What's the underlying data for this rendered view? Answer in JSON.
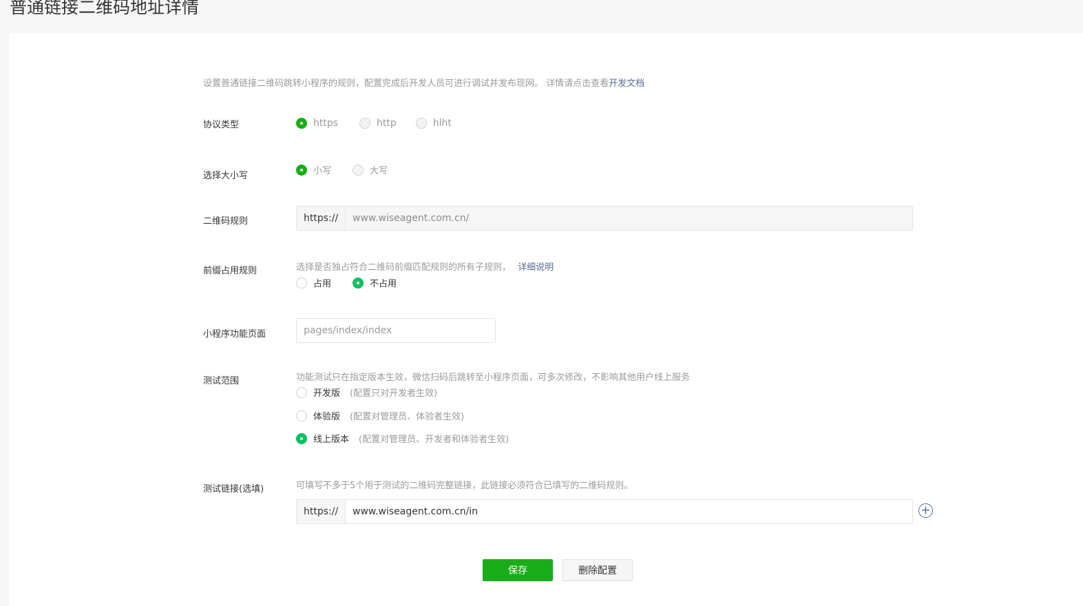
{
  "page_title": "普通链接二维码地址详情",
  "description": {
    "text": "设置普通链接二维码跳转小程序的规则，配置完成后开发人员可进行调试并发布现网。 详情请点击查看",
    "link": "开发文档"
  },
  "protocol": {
    "label": "协议类型",
    "options": [
      "https",
      "http",
      "hlht"
    ],
    "selected": "https"
  },
  "case": {
    "label": "选择大小写",
    "options": [
      "小写",
      "大写"
    ],
    "selected": "小写"
  },
  "qr_rule": {
    "label": "二维码规则",
    "prefix": "https://",
    "value": "www.wiseagent.com.cn/"
  },
  "prefix_rule": {
    "label": "前缀占用规则",
    "hint": "选择是否独占符合二维码前缀匹配规则的所有子规则，",
    "hint_link": "详细说明",
    "options": [
      "占用",
      "不占用"
    ],
    "selected": "不占用"
  },
  "page_path": {
    "label": "小程序功能页面",
    "placeholder": "pages/index/index"
  },
  "test_scope": {
    "label": "测试范围",
    "hint": "功能测试只在指定版本生效，微信扫码后跳转至小程序页面，可多次修改，不影响其他用户线上服务",
    "options": [
      {
        "name": "开发版",
        "note": "(配置只对开发者生效)"
      },
      {
        "name": "体验版",
        "note": "(配置对管理员、体验者生效)"
      },
      {
        "name": "线上版本",
        "note": "(配置对管理员、开发者和体验者生效)"
      }
    ],
    "selected": "线上版本"
  },
  "test_link": {
    "label": "测试链接(选填)",
    "hint": "可填写不多于5个用于测试的二维码完整链接，此链接必须符合已填写的二维码规则。",
    "prefix": "https://",
    "value": "www.wiseagent.com.cn/in",
    "add_icon": "plus-circle-icon"
  },
  "actions": {
    "save": "保存",
    "delete": "删除配置"
  },
  "colors": {
    "primary_green": "#1aad19",
    "link_blue": "#576b95"
  }
}
